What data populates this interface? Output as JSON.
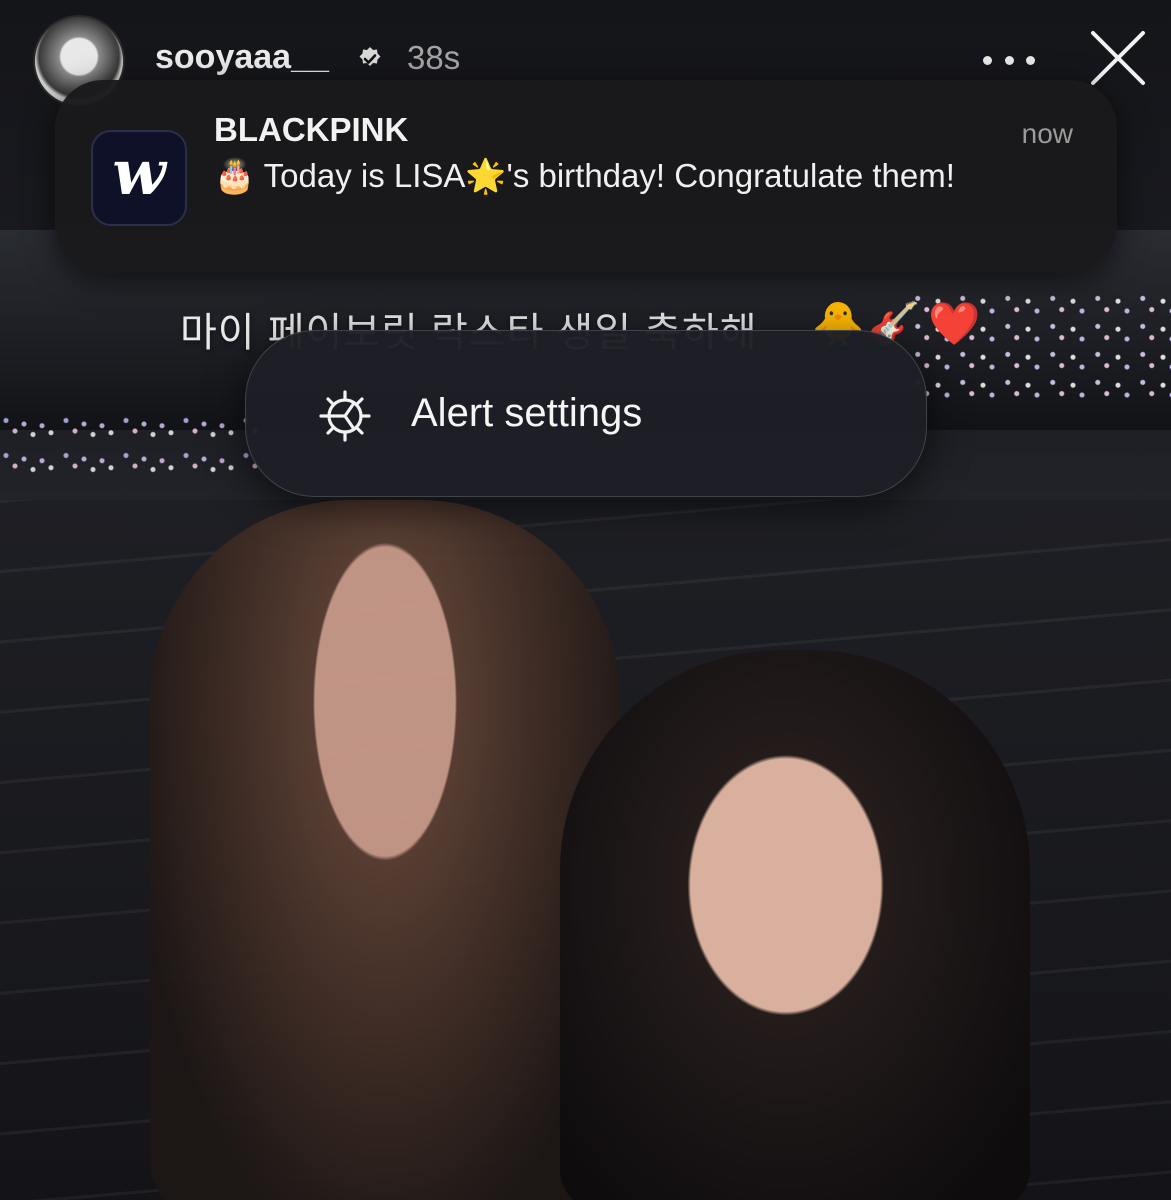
{
  "story": {
    "username": "sooyaaa__",
    "time_ago": "38s",
    "caption": "마이 페이보릿 락스타 생일 축하해"
  },
  "notification": {
    "app_name": "BLACKPINK",
    "time": "now",
    "app_icon_letter": "w",
    "message": "🎂 Today is LISA🌟's birthday! Congratulate them!"
  },
  "context_menu": {
    "items": [
      {
        "label": "Alert settings",
        "icon": "gear-icon"
      }
    ]
  },
  "icons": {
    "verified": "verified-badge-icon",
    "more": "more-dots-icon",
    "close": "close-icon"
  }
}
